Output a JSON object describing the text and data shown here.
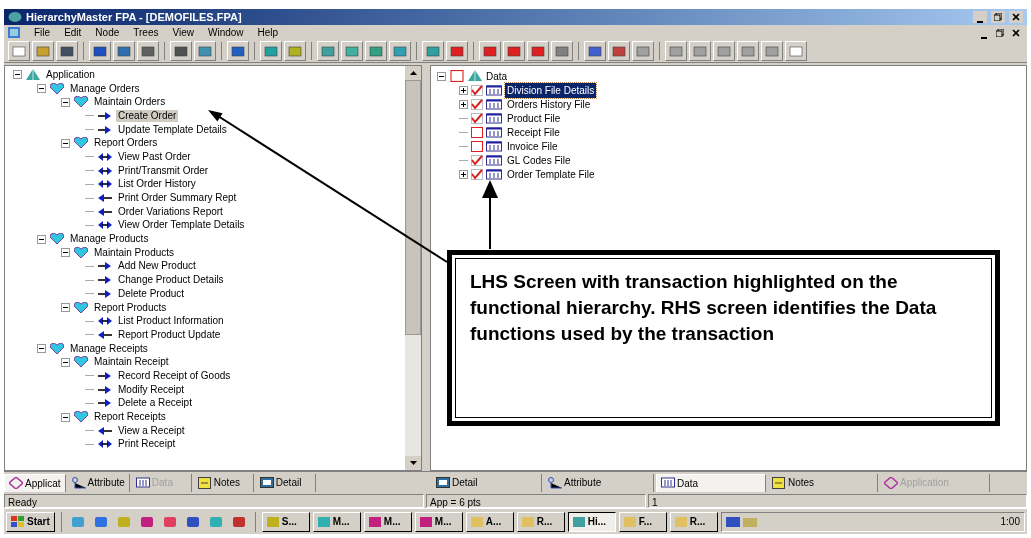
{
  "window": {
    "title": "HierarchyMaster FPA - [DEMOFILES.FPA]"
  },
  "menu": [
    "File",
    "Edit",
    "Node",
    "Trees",
    "View",
    "Window",
    "Help"
  ],
  "left_tree": [
    {
      "label": "Application",
      "kind": "root",
      "selected": false,
      "children": [
        {
          "label": "Manage Orders",
          "kind": "group",
          "selected": false,
          "children": [
            {
              "label": "Maintain Orders",
              "kind": "group",
              "selected": false,
              "children": [
                {
                  "label": "Create Order",
                  "kind": "input",
                  "selected": true
                },
                {
                  "label": "Update Template Details",
                  "kind": "input",
                  "selected": false
                }
              ]
            },
            {
              "label": "Report Orders",
              "kind": "group",
              "selected": false,
              "children": [
                {
                  "label": "View Past Order",
                  "kind": "inquiry",
                  "selected": false
                },
                {
                  "label": "Print/Transmit Order",
                  "kind": "inquiry",
                  "selected": false
                },
                {
                  "label": "List Order History",
                  "kind": "inquiry",
                  "selected": false
                },
                {
                  "label": "Print Order Summary Rept",
                  "kind": "output",
                  "selected": false
                },
                {
                  "label": "Order Variations Report",
                  "kind": "output",
                  "selected": false
                },
                {
                  "label": "View Order Template Details",
                  "kind": "inquiry",
                  "selected": false
                }
              ]
            }
          ]
        },
        {
          "label": "Manage Products",
          "kind": "group",
          "selected": false,
          "children": [
            {
              "label": "Maintain Products",
              "kind": "group",
              "selected": false,
              "children": [
                {
                  "label": "Add New Product",
                  "kind": "input",
                  "selected": false
                },
                {
                  "label": "Change Product Details",
                  "kind": "input",
                  "selected": false
                },
                {
                  "label": "Delete Product",
                  "kind": "input",
                  "selected": false
                }
              ]
            },
            {
              "label": "Report Products",
              "kind": "group",
              "selected": false,
              "children": [
                {
                  "label": "List Product Information",
                  "kind": "inquiry",
                  "selected": false
                },
                {
                  "label": "Report Product Update",
                  "kind": "output",
                  "selected": false
                }
              ]
            }
          ]
        },
        {
          "label": "Manage Receipts",
          "kind": "group",
          "selected": false,
          "children": [
            {
              "label": "Maintain Receipt",
              "kind": "group",
              "selected": false,
              "children": [
                {
                  "label": "Record Receipt of Goods",
                  "kind": "input",
                  "selected": false
                },
                {
                  "label": "Modify Receipt",
                  "kind": "input",
                  "selected": false
                },
                {
                  "label": "Delete a Receipt",
                  "kind": "input",
                  "selected": false
                }
              ]
            },
            {
              "label": "Report Receipts",
              "kind": "group",
              "selected": false,
              "children": [
                {
                  "label": "View a Receipt",
                  "kind": "output",
                  "selected": false
                },
                {
                  "label": "Print Receipt",
                  "kind": "inquiry",
                  "selected": false
                }
              ]
            }
          ]
        }
      ]
    }
  ],
  "right_tree": {
    "label": "Data",
    "checked": false,
    "children": [
      {
        "label": "Division File Details",
        "checked": true,
        "expandable": true,
        "selected": true
      },
      {
        "label": "Orders History File",
        "checked": true,
        "expandable": true,
        "selected": false
      },
      {
        "label": "Product File",
        "checked": true,
        "expandable": false,
        "selected": false
      },
      {
        "label": "Receipt File",
        "checked": false,
        "expandable": false,
        "selected": false
      },
      {
        "label": "Invoice File",
        "checked": false,
        "expandable": false,
        "selected": false
      },
      {
        "label": "GL Codes File",
        "checked": true,
        "expandable": false,
        "selected": false
      },
      {
        "label": "Order Template File",
        "checked": true,
        "expandable": true,
        "selected": false
      }
    ]
  },
  "callout": "LHS Screen with transaction highlighted on the functional hierarchy.  RHS screen identifies the Data functions used by the transaction",
  "left_tabs": [
    {
      "label": "Applicat",
      "selected": true,
      "disabled": false
    },
    {
      "label": "Attribute",
      "selected": false,
      "disabled": false
    },
    {
      "label": "Data",
      "selected": false,
      "disabled": true
    },
    {
      "label": "Notes",
      "selected": false,
      "disabled": false
    },
    {
      "label": "Detail",
      "selected": false,
      "disabled": false
    }
  ],
  "right_tabs": [
    {
      "label": "Detail",
      "selected": false,
      "disabled": false
    },
    {
      "label": "Attribute",
      "selected": false,
      "disabled": false
    },
    {
      "label": "Data",
      "selected": true,
      "disabled": false
    },
    {
      "label": "Notes",
      "selected": false,
      "disabled": false
    },
    {
      "label": "Application",
      "selected": false,
      "disabled": true
    }
  ],
  "status_bar": [
    "Ready",
    "App = 6 pts",
    "1"
  ],
  "taskbar": {
    "start": "Start",
    "tasks": [
      {
        "label": "S...",
        "selected": false
      },
      {
        "label": "M...",
        "selected": false
      },
      {
        "label": "M...",
        "selected": false
      },
      {
        "label": "M...",
        "selected": false
      },
      {
        "label": "A...",
        "selected": false
      },
      {
        "label": "R...",
        "selected": false
      },
      {
        "label": "Hi...",
        "selected": true
      },
      {
        "label": "F...",
        "selected": false
      },
      {
        "label": "R...",
        "selected": false
      }
    ],
    "clock": "1:00"
  }
}
